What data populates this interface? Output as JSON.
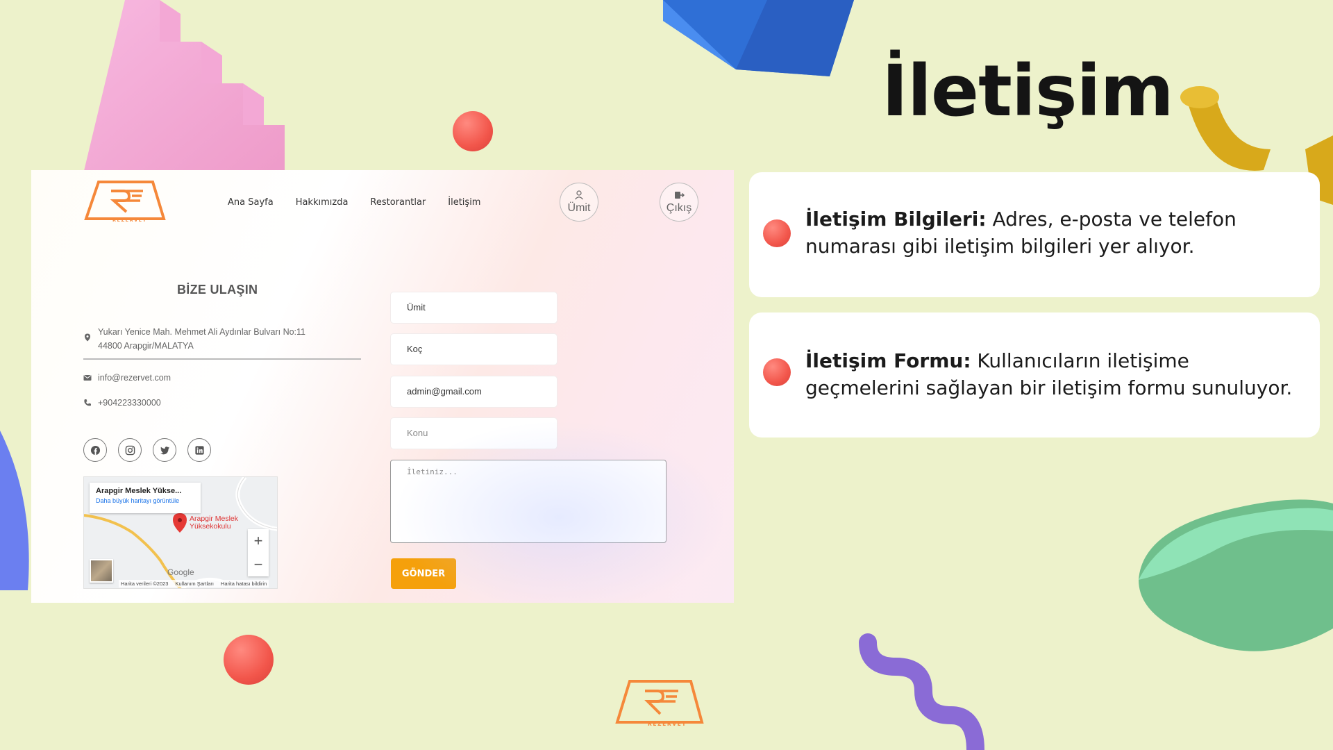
{
  "page": {
    "title": "İletişim"
  },
  "app": {
    "brand_label": "REZERVET",
    "nav": [
      "Ana Sayfa",
      "Hakkımızda",
      "Restorantlar",
      "İletişim"
    ],
    "user_button": "Ümit",
    "exit_button": "Çıkış"
  },
  "contact": {
    "title": "BİZE ULAŞIN",
    "address_line1": "Yukarı Yenice Mah. Mehmet Ali Aydınlar Bulvarı No:11",
    "address_line2": "44800 Arapgir/MALATYA",
    "email": "info@rezervet.com",
    "phone": "+904223330000"
  },
  "map": {
    "card_title": "Arapgir Meslek Yükse...",
    "card_link": "Daha büyük haritayı görüntüle",
    "pin_label_1": "Arapgir Meslek",
    "pin_label_2": "Yüksekokulu",
    "zoom_in": "+",
    "zoom_out": "−",
    "google": "Google",
    "footer": [
      "Harita verileri ©2023",
      "Kullanım Şartları",
      "Harita hatası bildirin"
    ]
  },
  "form": {
    "first_name": "Ümit",
    "last_name": "Koç",
    "email": "admin@gmail.com",
    "subject_placeholder": "Konu",
    "message_placeholder": "İletiniz...",
    "submit": "GÖNDER"
  },
  "cards": [
    {
      "heading": "İletişim Bilgileri:",
      "text": " Adres, e-posta ve telefon numarası gibi iletişim bilgileri yer alıyor."
    },
    {
      "heading": "İletişim Formu:",
      "text": " Kullanıcıların iletişime geçmelerini sağlayan bir iletişim formu sunuluyor."
    }
  ],
  "colors": {
    "background": "#edf2cb",
    "accent_orange": "#f5a00b",
    "logo_orange": "#f5883a",
    "dot_red": "#f2564b"
  }
}
